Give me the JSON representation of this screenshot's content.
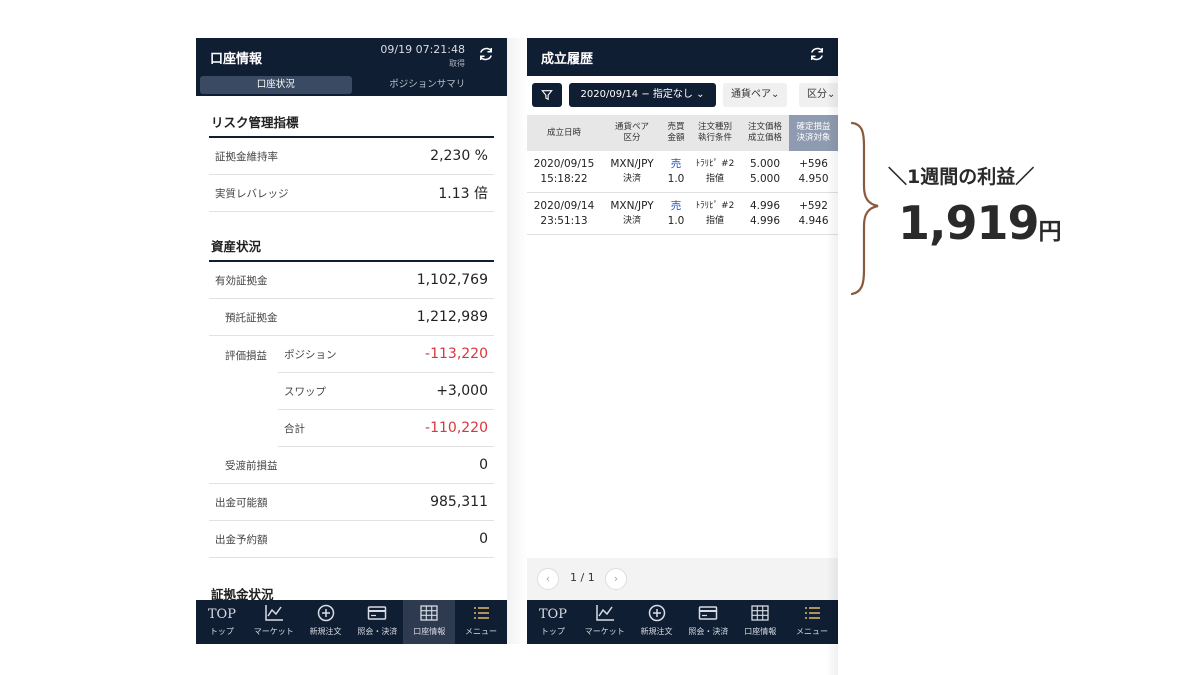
{
  "left": {
    "header": {
      "title": "口座情報",
      "time": "09/19 07:21:48",
      "sub": "取得",
      "icon": "refresh-icon"
    },
    "tabs": [
      {
        "label": "口座状況",
        "active": true
      },
      {
        "label": "ポジションサマリ",
        "active": false
      }
    ],
    "risk": {
      "title": "リスク管理指標",
      "rows": [
        {
          "label": "証拠金維持率",
          "value": "2,230 %"
        },
        {
          "label": "実質レバレッジ",
          "value": "1.13 倍"
        }
      ]
    },
    "assets": {
      "title": "資産状況",
      "effective": {
        "label": "有効証拠金",
        "value": "1,102,769"
      },
      "deposit": {
        "label": "預託証拠金",
        "value": "1,212,989"
      },
      "eval": {
        "label": "評価損益",
        "position": {
          "label": "ポジション",
          "value": "-113,220"
        },
        "swap": {
          "label": "スワップ",
          "value": "+3,000"
        },
        "total": {
          "label": "合計",
          "value": "-110,220"
        }
      },
      "pending": {
        "label": "受渡前損益",
        "value": "0"
      },
      "withdrawable": {
        "label": "出金可能額",
        "value": "985,311"
      },
      "scheduled": {
        "label": "出金予約額",
        "value": "0"
      }
    },
    "margin": {
      "title": "証拠金状況"
    }
  },
  "right": {
    "header": {
      "title": "成立履歴",
      "icon": "refresh-icon"
    },
    "filter": {
      "icon": "filter-icon",
      "date": "2020/09/14 − 指定なし ⌄",
      "pair": "通貨ペア⌄",
      "kind": "区分⌄"
    },
    "columns": [
      {
        "l1": "成立日時",
        "l2": ""
      },
      {
        "l1": "通貨ペア",
        "l2": "区分"
      },
      {
        "l1": "売買",
        "l2": "金額"
      },
      {
        "l1": "注文種別",
        "l2": "執行条件"
      },
      {
        "l1": "注文価格",
        "l2": "成立価格"
      },
      {
        "l1": "確定損益",
        "l2": "決済対象"
      }
    ],
    "rows": [
      {
        "date": "2020/09/15",
        "time": "15:18:22",
        "pair": "MXN/JPY",
        "kind": "決済",
        "side": "売",
        "amount": "1.0",
        "otype": "ﾄﾗﾘﾋﾟ #2",
        "cond": "指値",
        "oprice": "5.000",
        "fprice": "5.000",
        "pnl": "+596",
        "target": "4.950"
      },
      {
        "date": "2020/09/14",
        "time": "23:51:13",
        "pair": "MXN/JPY",
        "kind": "決済",
        "side": "売",
        "amount": "1.0",
        "otype": "ﾄﾗﾘﾋﾟ #2",
        "cond": "指値",
        "oprice": "4.996",
        "fprice": "4.996",
        "pnl": "+592",
        "target": "4.946"
      }
    ],
    "pager": {
      "text": "1 / 1",
      "prev": "‹",
      "next": "›"
    }
  },
  "nav": [
    {
      "icon_text": "TOP",
      "icon": "top-icon",
      "label": "トップ"
    },
    {
      "icon": "chart-icon",
      "label": "マーケット"
    },
    {
      "icon": "plus-circle-icon",
      "label": "新規注文"
    },
    {
      "icon": "card-icon",
      "label": "照会・決済"
    },
    {
      "icon": "grid-icon",
      "label": "口座情報"
    },
    {
      "icon": "menu-icon",
      "label": "メニュー"
    }
  ],
  "annotation": {
    "title": "＼1週間の利益／",
    "amount": "1,919",
    "unit": "円"
  },
  "colors": {
    "header": "#101e33",
    "negative": "#d9363e",
    "sell": "#2c54c0",
    "brace": "#8a5a3c"
  }
}
